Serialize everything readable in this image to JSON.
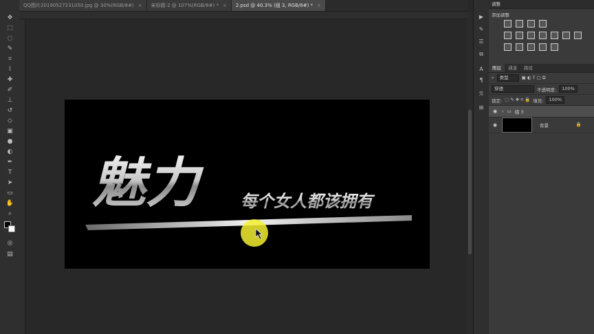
{
  "tabs": [
    {
      "label": "QQ图片20190527231050.jpg @ 30%(RGB/8#)",
      "close": "×",
      "active": false
    },
    {
      "label": "未标题-2 @ 107%(RGB/8#) *",
      "close": "×",
      "active": false
    },
    {
      "label": "2.psd @ 40.3% (组 3, RGB/8#) *",
      "close": "×",
      "active": true
    }
  ],
  "canvas": {
    "main_title": "魅力",
    "subtitle": "每个女人都该拥有",
    "background_color": "#000000",
    "highlight_color": "#f3ef2f"
  },
  "panels": {
    "adjustments": {
      "header": "调整",
      "title": "添加调整"
    },
    "layers": {
      "tabs": [
        "图层",
        "通道",
        "路径"
      ],
      "filter_kind": "类型",
      "blend_mode": "穿透",
      "opacity_label": "不透明度:",
      "opacity_value": "100%",
      "lock_label": "锁定:",
      "fill_label": "填充:",
      "fill_value": "100%",
      "items": [
        {
          "name": "组 3",
          "type": "group",
          "selected": true
        },
        {
          "name": "背景",
          "type": "background",
          "selected": false
        }
      ]
    }
  }
}
